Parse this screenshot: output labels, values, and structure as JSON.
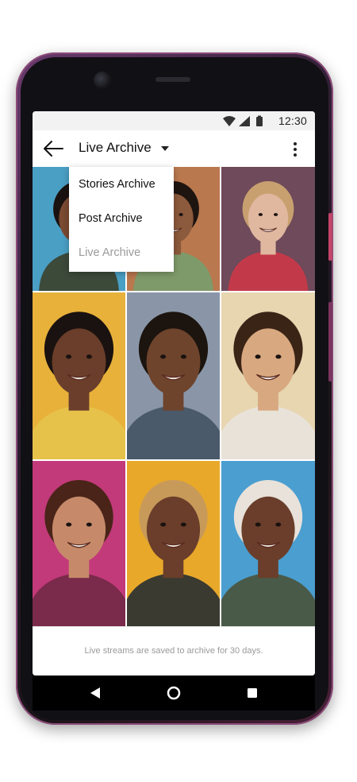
{
  "status_bar": {
    "time": "12:30"
  },
  "app_bar": {
    "title": "Live Archive"
  },
  "dropdown": {
    "items": [
      {
        "label": "Stories Archive",
        "active": false
      },
      {
        "label": "Post Archive",
        "active": false
      },
      {
        "label": "Live Archive",
        "active": true
      }
    ]
  },
  "footer": {
    "text": "Live streams are saved to archive for 30 days."
  },
  "tiles": [
    {
      "bg": "#4a9fc4",
      "skin": "#7a4a32",
      "shirt": "#3c4a3a",
      "hair": "#1a1210"
    },
    {
      "bg": "#b9784e",
      "skin": "#8c5a3c",
      "shirt": "#7f9a6a",
      "hair": "#1e1410"
    },
    {
      "bg": "#6e4a5a",
      "skin": "#e0b8a0",
      "shirt": "#c23a4a",
      "hair": "#c8a070"
    },
    {
      "bg": "#e8b13a",
      "skin": "#6a3e2a",
      "shirt": "#e6c24a",
      "hair": "#1a1210"
    },
    {
      "bg": "#8a96a8",
      "skin": "#6e442c",
      "shirt": "#4a5a6a",
      "hair": "#1c140e"
    },
    {
      "bg": "#e7d6b0",
      "skin": "#d8a880",
      "shirt": "#e8e2d8",
      "hair": "#3a2416"
    },
    {
      "bg": "#c23a7a",
      "skin": "#c68a6a",
      "shirt": "#7a2a4a",
      "hair": "#4a2418"
    },
    {
      "bg": "#e8a82a",
      "skin": "#6a3e2a",
      "shirt": "#3a3a30",
      "hair": "#c89a5a"
    },
    {
      "bg": "#4a9ed0",
      "skin": "#6a3e2a",
      "shirt": "#4a5a48",
      "hair": "#e8e2da"
    }
  ]
}
